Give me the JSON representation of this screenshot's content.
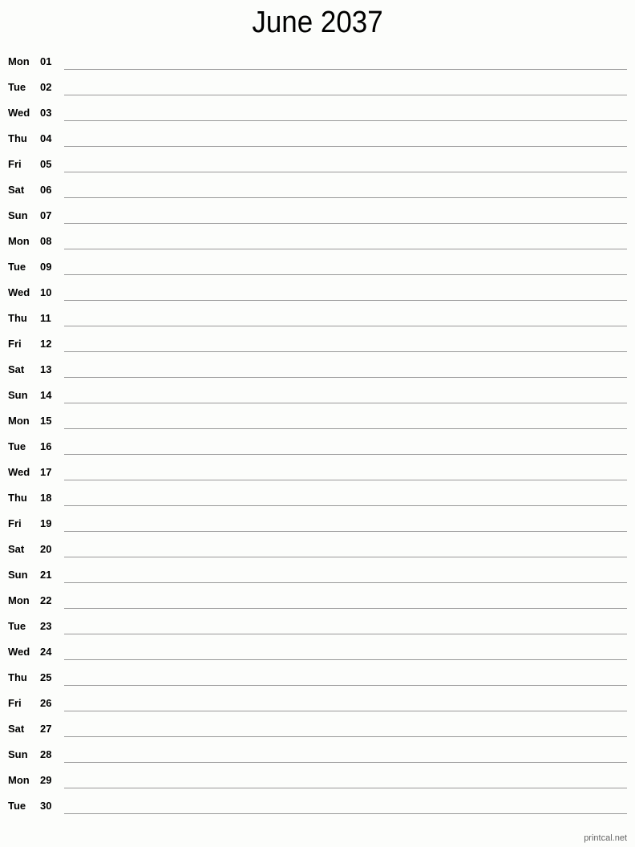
{
  "title": "June 2037",
  "days": [
    {
      "weekday": "Mon",
      "date": "01"
    },
    {
      "weekday": "Tue",
      "date": "02"
    },
    {
      "weekday": "Wed",
      "date": "03"
    },
    {
      "weekday": "Thu",
      "date": "04"
    },
    {
      "weekday": "Fri",
      "date": "05"
    },
    {
      "weekday": "Sat",
      "date": "06"
    },
    {
      "weekday": "Sun",
      "date": "07"
    },
    {
      "weekday": "Mon",
      "date": "08"
    },
    {
      "weekday": "Tue",
      "date": "09"
    },
    {
      "weekday": "Wed",
      "date": "10"
    },
    {
      "weekday": "Thu",
      "date": "11"
    },
    {
      "weekday": "Fri",
      "date": "12"
    },
    {
      "weekday": "Sat",
      "date": "13"
    },
    {
      "weekday": "Sun",
      "date": "14"
    },
    {
      "weekday": "Mon",
      "date": "15"
    },
    {
      "weekday": "Tue",
      "date": "16"
    },
    {
      "weekday": "Wed",
      "date": "17"
    },
    {
      "weekday": "Thu",
      "date": "18"
    },
    {
      "weekday": "Fri",
      "date": "19"
    },
    {
      "weekday": "Sat",
      "date": "20"
    },
    {
      "weekday": "Sun",
      "date": "21"
    },
    {
      "weekday": "Mon",
      "date": "22"
    },
    {
      "weekday": "Tue",
      "date": "23"
    },
    {
      "weekday": "Wed",
      "date": "24"
    },
    {
      "weekday": "Thu",
      "date": "25"
    },
    {
      "weekday": "Fri",
      "date": "26"
    },
    {
      "weekday": "Sat",
      "date": "27"
    },
    {
      "weekday": "Sun",
      "date": "28"
    },
    {
      "weekday": "Mon",
      "date": "29"
    },
    {
      "weekday": "Tue",
      "date": "30"
    }
  ],
  "footer": "printcal.net"
}
